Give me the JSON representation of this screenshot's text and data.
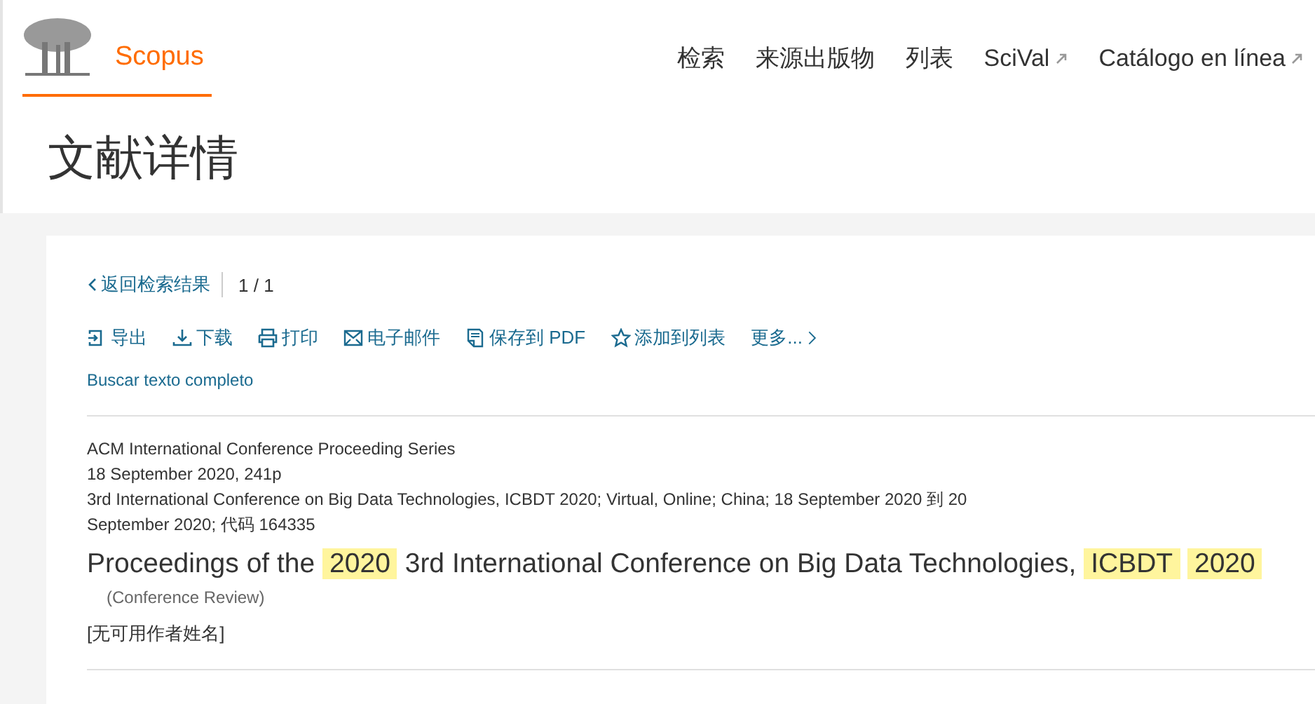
{
  "header": {
    "logo_text": "Scopus",
    "nav": [
      {
        "label": "检索",
        "external": false
      },
      {
        "label": "来源出版物",
        "external": false
      },
      {
        "label": "列表",
        "external": false
      },
      {
        "label": "SciVal",
        "external": true
      },
      {
        "label": "Catálogo en línea",
        "external": true
      }
    ]
  },
  "page_title": "文献详情",
  "back_link": "返回检索结果",
  "pager": "1 / 1",
  "actions": [
    {
      "kind": "export",
      "label": "导出"
    },
    {
      "kind": "download",
      "label": "下载"
    },
    {
      "kind": "print",
      "label": "打印"
    },
    {
      "kind": "email",
      "label": "电子邮件"
    },
    {
      "kind": "pdf",
      "label": "保存到 PDF"
    },
    {
      "kind": "star",
      "label": "添加到列表"
    },
    {
      "kind": "more",
      "label": "更多..."
    }
  ],
  "full_text_link": "Buscar texto completo",
  "source_lines": [
    "ACM International Conference Proceeding Series",
    "18 September 2020, 241p",
    "3rd International Conference on Big Data Technologies, ICBDT 2020; Virtual, Online; China; 18 September 2020 到 20 September 2020; 代码 164335"
  ],
  "doc_title": [
    {
      "text": "Proceedings of the",
      "highlighted": false
    },
    {
      "text": "2020",
      "highlighted": true
    },
    {
      "text": "3rd International Conference on Big Data Technologies,",
      "highlighted": false
    },
    {
      "text": "ICBDT",
      "highlighted": true
    },
    {
      "text": "2020",
      "highlighted": true
    }
  ],
  "doc_type": "(Conference Review)",
  "authors": "[无可用作者姓名]"
}
